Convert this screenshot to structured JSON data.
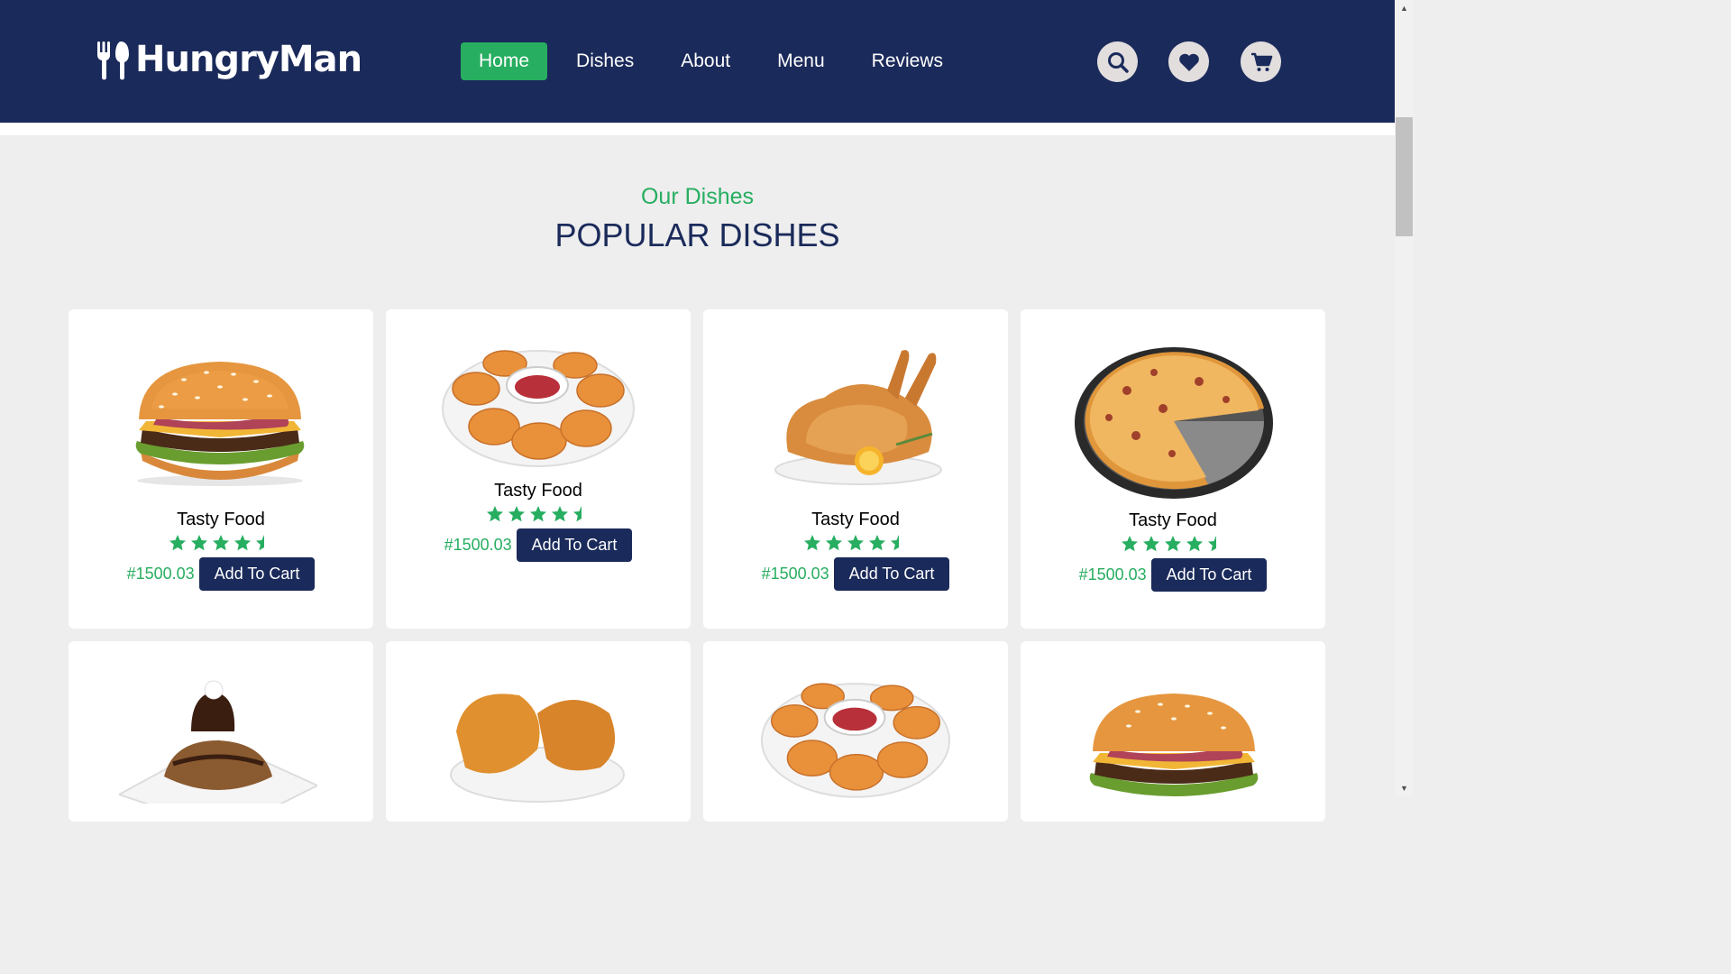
{
  "brand": {
    "name": "HungryMan",
    "logo_icon": "fork-spoon-icon"
  },
  "nav": {
    "items": [
      {
        "label": "Home",
        "active": true
      },
      {
        "label": "Dishes",
        "active": false
      },
      {
        "label": "About",
        "active": false
      },
      {
        "label": "Menu",
        "active": false
      },
      {
        "label": "Reviews",
        "active": false
      }
    ]
  },
  "header_icons": [
    "search-icon",
    "heart-icon",
    "cart-icon"
  ],
  "colors": {
    "navy": "#1a2a5a",
    "green": "#27ae60",
    "page_bg": "#eeeeee",
    "icon_bg": "#e2dede"
  },
  "section": {
    "subheading": "Our Dishes",
    "heading": "POPULAR DISHES"
  },
  "dishes": [
    {
      "name": "Tasty Food",
      "rating": 4.5,
      "price": "#1500.03",
      "button": "Add To Cart",
      "image": "burger"
    },
    {
      "name": "Tasty Food",
      "rating": 4.5,
      "price": "#1500.03",
      "button": "Add To Cart",
      "image": "chicken-nuggets"
    },
    {
      "name": "Tasty Food",
      "rating": 4.5,
      "price": "#1500.03",
      "button": "Add To Cart",
      "image": "roast-chicken"
    },
    {
      "name": "Tasty Food",
      "rating": 4.5,
      "price": "#1500.03",
      "button": "Add To Cart",
      "image": "pizza"
    },
    {
      "name": "",
      "rating": null,
      "price": "",
      "button": "",
      "image": "chocolate-cake"
    },
    {
      "name": "",
      "rating": null,
      "price": "",
      "button": "",
      "image": "fried-chicken"
    },
    {
      "name": "",
      "rating": null,
      "price": "",
      "button": "",
      "image": "chicken-nuggets"
    },
    {
      "name": "",
      "rating": null,
      "price": "",
      "button": "",
      "image": "burger"
    }
  ]
}
